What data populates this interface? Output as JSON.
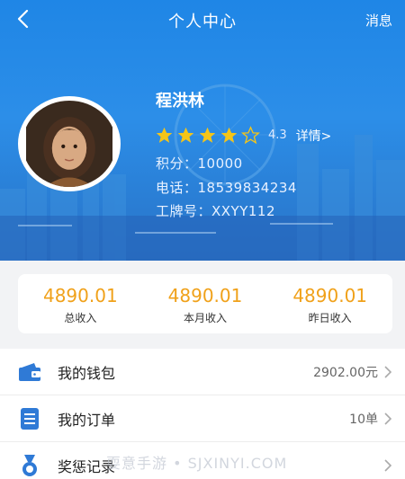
{
  "header": {
    "title": "个人中心",
    "messages_label": "消息"
  },
  "profile": {
    "name": "程洪林",
    "rating": "4.3",
    "stars_filled": 4,
    "stars_total": 5,
    "detail_link": "详情>",
    "points": "积分：10000",
    "phone": "电话：18539834234",
    "badge_no": "工牌号：XXYY112"
  },
  "stats": [
    {
      "value": "4890.01",
      "label": "总收入"
    },
    {
      "value": "4890.01",
      "label": "本月收入"
    },
    {
      "value": "4890.01",
      "label": "昨日收入"
    }
  ],
  "menu": [
    {
      "label": "我的钱包",
      "value": "2902.00元",
      "icon": "wallet-icon"
    },
    {
      "label": "我的订单",
      "value": "10单",
      "icon": "order-list-icon"
    },
    {
      "label": "奖惩记录",
      "value": "",
      "icon": "medal-icon"
    }
  ],
  "watermark": "耍意手游 • SJXINYI.COM",
  "colors": {
    "header_blue": "#2c8ee8",
    "accent_orange": "#f0a11a",
    "star_yellow": "#f5c518",
    "icon_blue": "#2f7ad6"
  }
}
